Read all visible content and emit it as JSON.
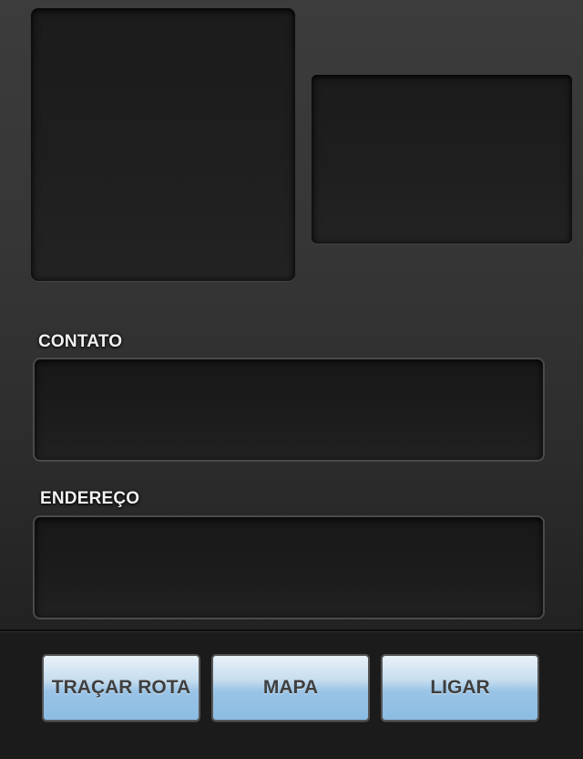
{
  "form": {
    "contact_label": "CONTATO",
    "contact_value": "",
    "address_label": "ENDEREÇO",
    "address_value": ""
  },
  "toolbar": {
    "route_label": "TRAÇAR ROTA",
    "map_label": "MAPA",
    "call_label": "LIGAR"
  },
  "colors": {
    "button_gradient_top": "#e9f1f8",
    "button_gradient_bottom": "#8cbce3",
    "button_text": "#3f3f3f",
    "label_text": "#f2f2f2"
  }
}
